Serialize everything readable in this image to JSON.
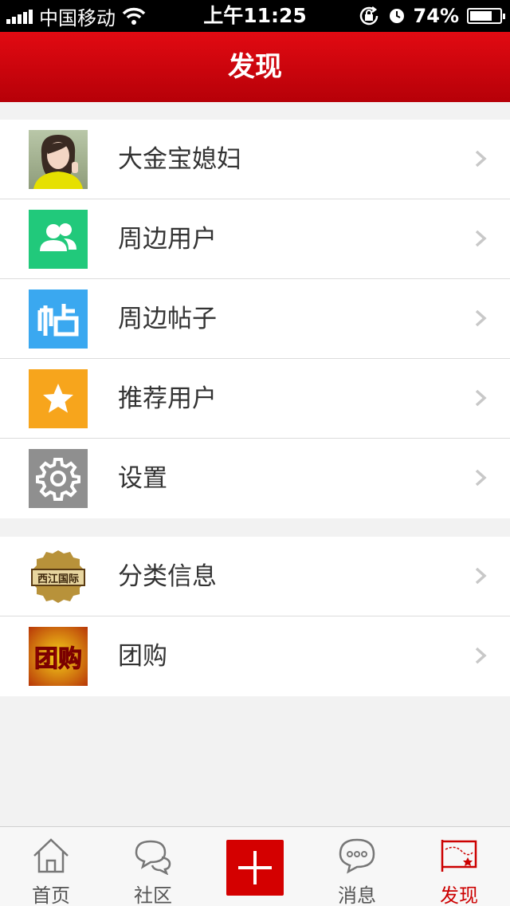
{
  "status_bar": {
    "carrier": "中国移动",
    "time": "上午11:25",
    "battery": "74%",
    "battery_level": 0.74
  },
  "header": {
    "title": "发现"
  },
  "groups": [
    {
      "items": [
        {
          "label": "大金宝媳妇",
          "icon": "user-avatar"
        },
        {
          "label": "周边用户",
          "icon": "users-icon",
          "color": "#21c97b"
        },
        {
          "label": "周边帖子",
          "icon": "post-icon",
          "color": "#3aa8f0"
        },
        {
          "label": "推荐用户",
          "icon": "star-icon",
          "color": "#f7a51c"
        },
        {
          "label": "设置",
          "icon": "gear-icon",
          "color": "#8f8f8f"
        }
      ]
    },
    {
      "items": [
        {
          "label": "分类信息",
          "icon": "category-logo"
        },
        {
          "label": "团购",
          "icon": "group-buy-logo"
        }
      ]
    }
  ],
  "logos": {
    "category_logo_text": "西江国际",
    "group_buy_logo_text": "团购"
  },
  "tabs": [
    {
      "label": "首页",
      "icon": "home-icon"
    },
    {
      "label": "社区",
      "icon": "chat-bubbles-icon"
    },
    {
      "label": "",
      "icon": "plus-icon"
    },
    {
      "label": "消息",
      "icon": "message-icon"
    },
    {
      "label": "发现",
      "icon": "discover-flag-icon",
      "active": true
    }
  ],
  "colors": {
    "accent": "#d40000",
    "header_top": "#e20a12",
    "header_bottom": "#b60008"
  }
}
